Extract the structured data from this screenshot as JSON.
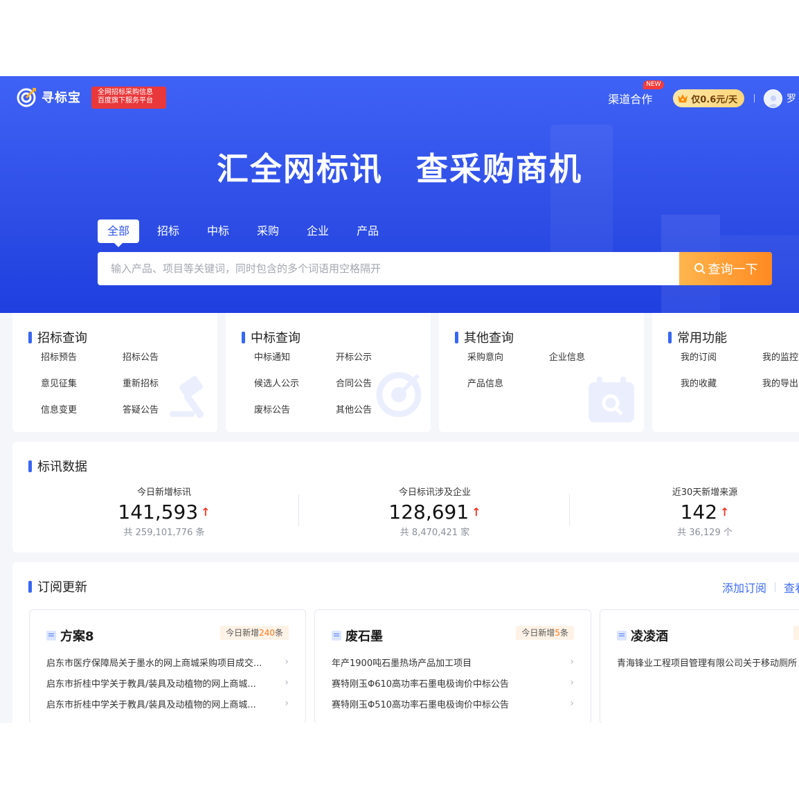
{
  "brand": {
    "name": "寻标宝",
    "slogan_line1": "全网招标采购信息",
    "slogan_line2": "百度旗下服务平台"
  },
  "topnav": {
    "channel": "渠道合作",
    "new_badge": "NEW",
    "price": "仅0.6元/天",
    "username": "罗"
  },
  "hero": {
    "headline": "汇全网标讯　查采购商机"
  },
  "search": {
    "tabs": [
      "全部",
      "招标",
      "中标",
      "采购",
      "企业",
      "产品"
    ],
    "active_tab": "全部",
    "placeholder": "输入产品、项目等关键词，同时包含的多个词语用空格隔开",
    "button": "查询一下"
  },
  "query_cards": [
    {
      "title": "招标查询",
      "links": [
        "招标预告",
        "招标公告",
        "意见征集",
        "重新招标",
        "信息变更",
        "答疑公告"
      ]
    },
    {
      "title": "中标查询",
      "links": [
        "中标通知",
        "开标公示",
        "候选人公示",
        "合同公告",
        "废标公告",
        "其他公告"
      ]
    },
    {
      "title": "其他查询",
      "links": [
        "采购意向",
        "企业信息",
        "产品信息"
      ]
    },
    {
      "title": "常用功能",
      "links": [
        "我的订阅",
        "我的监控",
        "我的收藏",
        "我的导出"
      ]
    }
  ],
  "stats": {
    "title": "标讯数据",
    "items": [
      {
        "label": "今日新增标讯",
        "value": "141,593",
        "total": "共 259,101,776 条"
      },
      {
        "label": "今日标讯涉及企业",
        "value": "128,691",
        "total": "共 8,470,421 家"
      },
      {
        "label": "近30天新增来源",
        "value": "142",
        "total": "共 36,129 个"
      }
    ]
  },
  "subscriptions": {
    "title": "订阅更新",
    "add_label": "添加订阅",
    "view_label": "查看",
    "cards": [
      {
        "keyword": "方案8",
        "today_prefix": "今日新增",
        "today_count": "240",
        "today_suffix": "条",
        "items": [
          "启东市医疗保障局关于墨水的网上商城采购项目成交...",
          "启东市折桂中学关于教具/装具及动植物的网上商城...",
          "启东市折桂中学关于教具/装具及动植物的网上商城..."
        ]
      },
      {
        "keyword": "废石墨",
        "today_prefix": "今日新增",
        "today_count": "5",
        "today_suffix": "条",
        "items": [
          "年产1900吨石墨热场产品加工项目",
          "赛特刚玉Φ610高功率石墨电极询价中标公告",
          "赛特刚玉Φ510高功率石墨电极询价中标公告"
        ]
      },
      {
        "keyword": "凌凌酒",
        "today_prefix": "",
        "today_count": "",
        "today_suffix": "",
        "items": [
          "青海锋业工程项目管理有限公司关于移动厕所"
        ]
      }
    ]
  },
  "colors": {
    "primary": "#2f56ee",
    "accent": "#ff8a22",
    "alert": "#f0392b",
    "badge_red": "#e8383b"
  }
}
